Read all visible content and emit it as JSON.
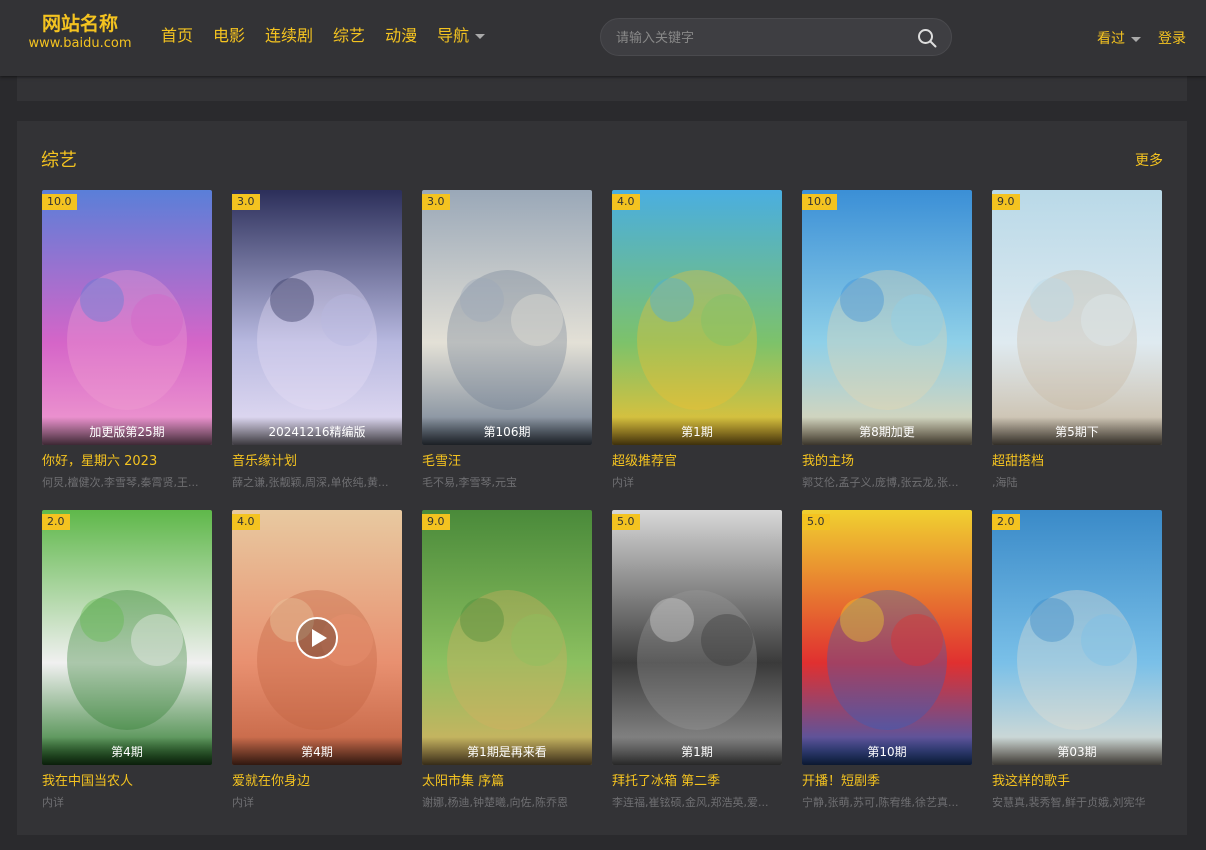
{
  "header": {
    "logo_line1": "网站名称",
    "logo_line2": "www.baidu.com",
    "nav": [
      "首页",
      "电影",
      "连续剧",
      "综艺",
      "动漫",
      "导航"
    ],
    "search_placeholder": "请输入关键字",
    "history_label": "看过",
    "login_label": "登录"
  },
  "section": {
    "title": "综艺",
    "more_label": "更多"
  },
  "colors": {
    "accent": "#f4c320",
    "background": "#2a2a2d",
    "panel": "#333336"
  },
  "cards": [
    {
      "score": "10.0",
      "episode": "加更版第25期",
      "title": "你好，星期六 2023",
      "cast": "何炅,檀健次,李雪琴,秦霄贤,王...",
      "colors": [
        "#5a7fd8",
        "#d565c8",
        "#f2a0d0"
      ]
    },
    {
      "score": "3.0",
      "episode": "20241216精编版",
      "title": "音乐缘计划",
      "cast": "薛之谦,张靓颖,周深,单依纯,黄...",
      "colors": [
        "#2c2f5a",
        "#b8b9e0",
        "#e8e0f5"
      ]
    },
    {
      "score": "3.0",
      "episode": "第106期",
      "title": "毛雪汪",
      "cast": "毛不易,李雪琴,元宝",
      "colors": [
        "#9aa8b8",
        "#e3e0d6",
        "#6f7e92"
      ]
    },
    {
      "score": "4.0",
      "episode": "第1期",
      "title": "超级推荐官",
      "cast": "内详",
      "colors": [
        "#4aaee0",
        "#7dc26a",
        "#f4c030"
      ]
    },
    {
      "score": "10.0",
      "episode": "第8期加更",
      "title": "我的主场",
      "cast": "郭艾伦,孟子义,庞博,张云龙,张...",
      "colors": [
        "#3b8fd6",
        "#8fd0e8",
        "#e8d6b0"
      ]
    },
    {
      "score": "9.0",
      "episode": "第5期下",
      "title": "超甜搭档",
      "cast": ",海陆",
      "colors": [
        "#b9d9e8",
        "#dfeaf0",
        "#c8b8a0"
      ]
    },
    {
      "score": "2.0",
      "episode": "第4期",
      "title": "我在中国当农人",
      "cast": "内详",
      "colors": [
        "#5fb84a",
        "#f0f0f0",
        "#2b7a2b"
      ]
    },
    {
      "score": "4.0",
      "episode": "第4期",
      "title": "爱就在你身边",
      "cast": "内详",
      "colors": [
        "#e8c9a0",
        "#e89070",
        "#c06040"
      ]
    },
    {
      "score": "9.0",
      "episode": "第1期是再来看",
      "title": "太阳市集 序篇",
      "cast": "谢娜,杨迪,钟楚曦,向佐,陈乔恩",
      "colors": [
        "#4a8a3a",
        "#8cc060",
        "#d8b060"
      ]
    },
    {
      "score": "5.0",
      "episode": "第1期",
      "title": "拜托了冰箱 第二季",
      "cast": "李连福,崔铉硕,金风,郑浩英,爱...",
      "colors": [
        "#d8d8d8",
        "#3a3a3a",
        "#9a9a9a"
      ]
    },
    {
      "score": "5.0",
      "episode": "第10期",
      "title": "开播！短剧季",
      "cast": "宁静,张萌,苏可,陈宥维,徐艺真...",
      "colors": [
        "#f0d030",
        "#e03030",
        "#3060c0"
      ]
    },
    {
      "score": "2.0",
      "episode": "第03期",
      "title": "我这样的歌手",
      "cast": "安慧真,裴秀智,鲜于贞娥,刘宪华",
      "colors": [
        "#3a8ac8",
        "#7ac0e8",
        "#e8e0d0"
      ]
    }
  ]
}
